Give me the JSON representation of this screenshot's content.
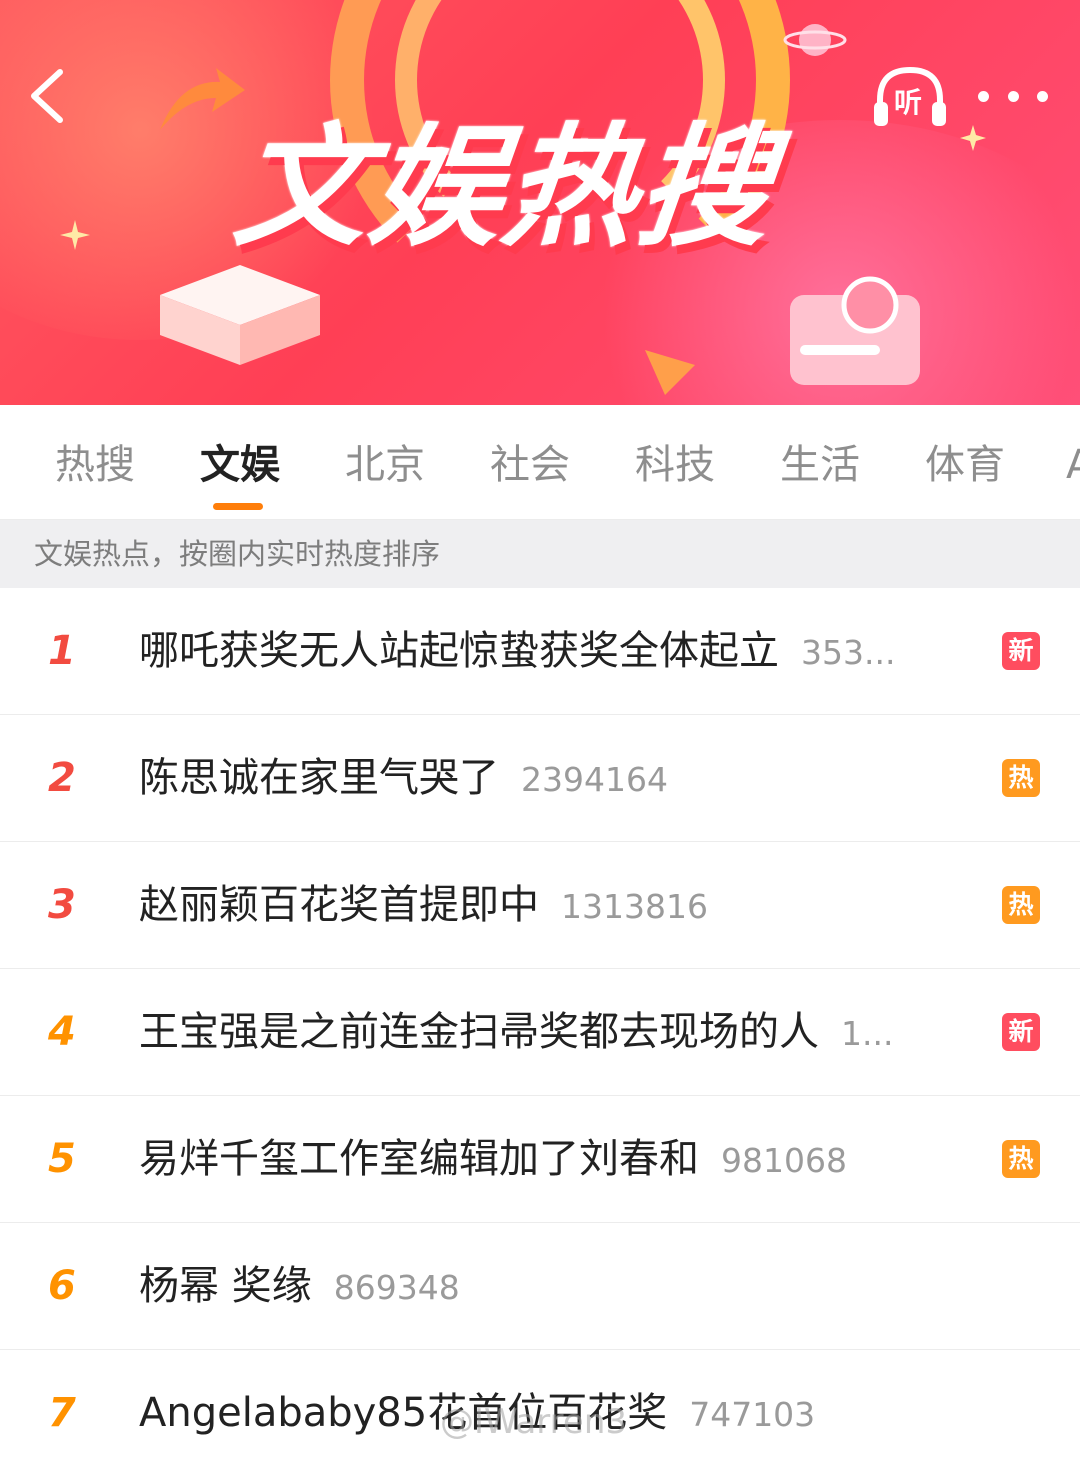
{
  "header": {
    "title": "文娱热搜",
    "listen_label": "听"
  },
  "tabs": [
    {
      "label": "热搜"
    },
    {
      "label": "文娱",
      "active": true
    },
    {
      "label": "北京"
    },
    {
      "label": "社会"
    },
    {
      "label": "科技"
    },
    {
      "label": "生活"
    },
    {
      "label": "体育"
    },
    {
      "label": "A"
    }
  ],
  "hint": "文娱热点，按圈内实时热度排序",
  "list": [
    {
      "rank": "1",
      "topic": "哪吒获奖无人站起惊蛰获奖全体起立",
      "count": "353...",
      "badge": "新"
    },
    {
      "rank": "2",
      "topic": "陈思诚在家里气哭了",
      "count": "2394164",
      "badge": "热"
    },
    {
      "rank": "3",
      "topic": "赵丽颖百花奖首提即中",
      "count": "1313816",
      "badge": "热"
    },
    {
      "rank": "4",
      "topic": "王宝强是之前连金扫帚奖都去现场的人",
      "count": "1...",
      "badge": "新"
    },
    {
      "rank": "5",
      "topic": "易烊千玺工作室编辑加了刘春和",
      "count": "981068",
      "badge": "热"
    },
    {
      "rank": "6",
      "topic": "杨幂 奖缘",
      "count": "869348",
      "badge": ""
    },
    {
      "rank": "7",
      "topic": "Angelababy85花首位百花奖",
      "count": "747103",
      "badge": ""
    }
  ],
  "watermark": "@IWarren3",
  "colors": {
    "accent": "#ff7e0a",
    "rank_top": "#f24b40",
    "rank_other": "#ff9200",
    "badge_new": "#ff4d5f",
    "badge_hot": "#ff9a1f"
  },
  "icons": {
    "back": "back-arrow-icon",
    "listen": "headphones-icon",
    "more": "more-dots-icon"
  }
}
